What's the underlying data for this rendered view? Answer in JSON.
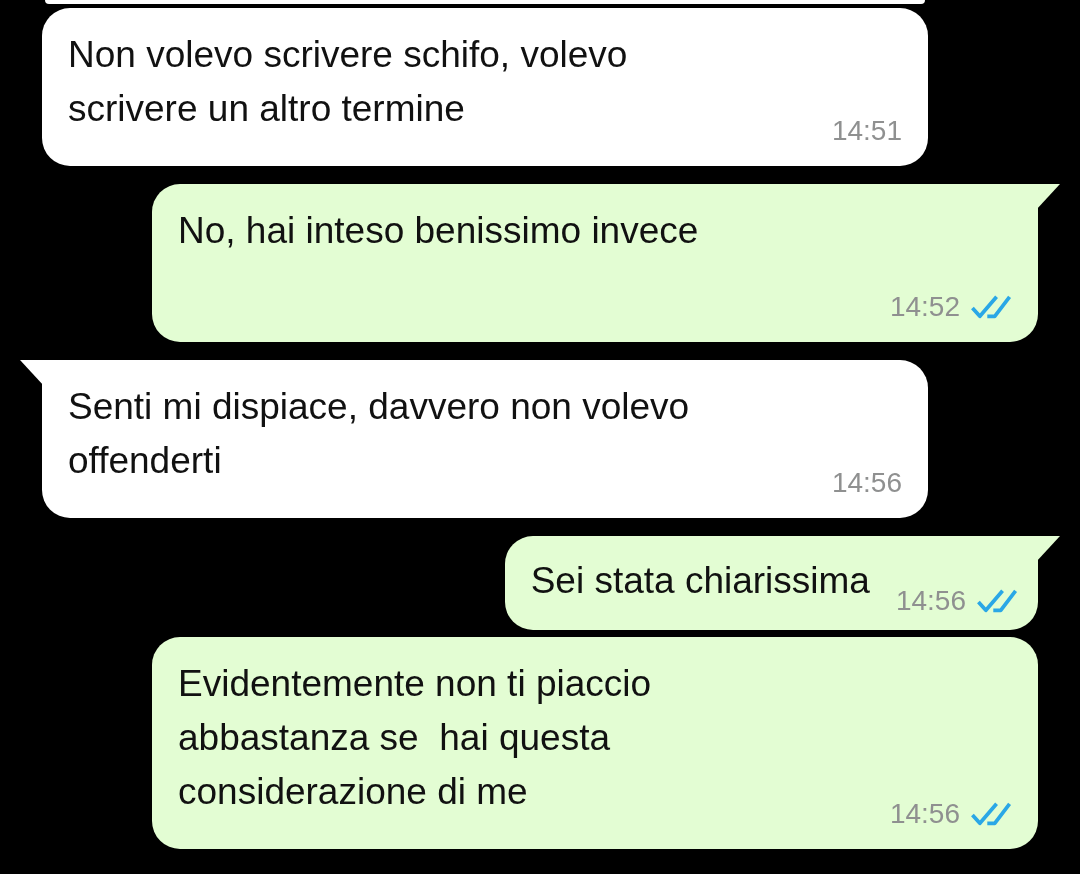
{
  "cut_off_bubble": {
    "kind": "received"
  },
  "messages": [
    {
      "kind": "received",
      "tail": false,
      "lines": [
        "Non volevo scrivere schifo, volevo",
        "scrivere un altro termine"
      ],
      "time": "14:51"
    },
    {
      "kind": "sent",
      "tail": true,
      "lines": [
        "No, hai inteso benissimo invece"
      ],
      "time": "14:52",
      "read": true
    },
    {
      "kind": "received",
      "tail": true,
      "lines": [
        "Senti mi dispiace, davvero non volevo",
        "offenderti"
      ],
      "time": "14:56"
    },
    {
      "kind": "sent-inline",
      "tail": true,
      "lines": [
        "Sei stata chiarissima"
      ],
      "time": "14:56",
      "read": true
    },
    {
      "kind": "sent",
      "tail": false,
      "lines": [
        "Evidentemente non ti piaccio",
        "abbastanza se  hai questa",
        "considerazione di me"
      ],
      "time": "14:56",
      "read": true
    }
  ]
}
